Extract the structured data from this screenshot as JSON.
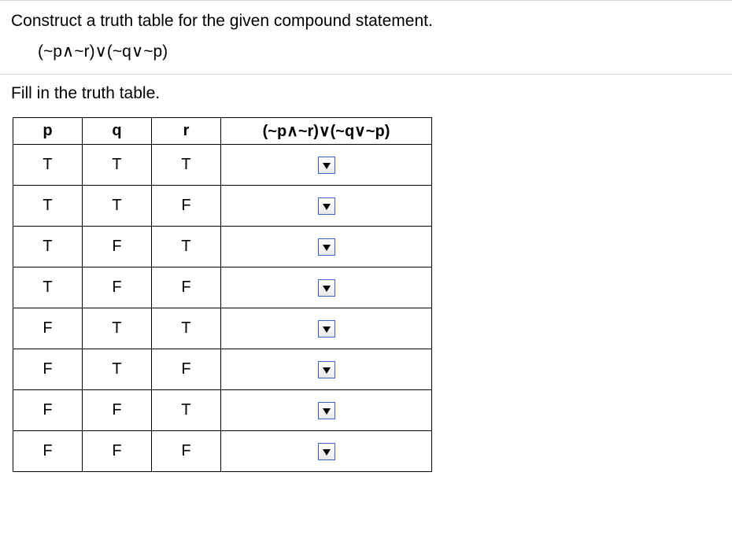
{
  "question": {
    "prompt": "Construct a truth table for the given compound statement.",
    "formula": "(~p∧~r)∨(~q∨~p)"
  },
  "instruction": "Fill in the truth table.",
  "table": {
    "headers": [
      "p",
      "q",
      "r",
      "(~p∧~r)∨(~q∨~p)"
    ],
    "rows": [
      {
        "p": "T",
        "q": "T",
        "r": "T",
        "answer": ""
      },
      {
        "p": "T",
        "q": "T",
        "r": "F",
        "answer": ""
      },
      {
        "p": "T",
        "q": "F",
        "r": "T",
        "answer": ""
      },
      {
        "p": "T",
        "q": "F",
        "r": "F",
        "answer": ""
      },
      {
        "p": "F",
        "q": "T",
        "r": "T",
        "answer": ""
      },
      {
        "p": "F",
        "q": "T",
        "r": "F",
        "answer": ""
      },
      {
        "p": "F",
        "q": "F",
        "r": "T",
        "answer": ""
      },
      {
        "p": "F",
        "q": "F",
        "r": "F",
        "answer": ""
      }
    ]
  }
}
